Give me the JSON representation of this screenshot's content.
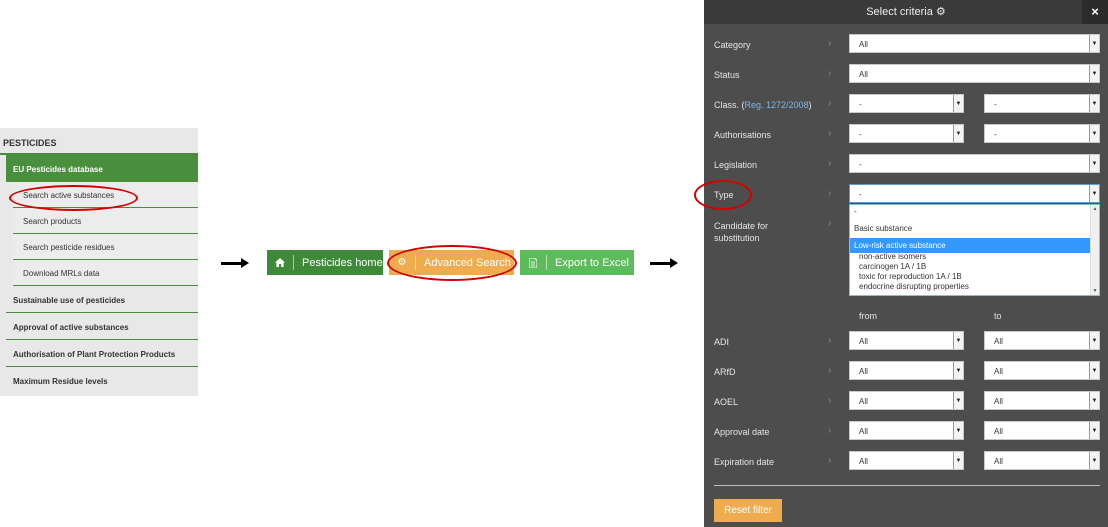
{
  "menu": {
    "header": "PESTICIDES",
    "active": "EU Pesticides database",
    "subitems": [
      "Search active substances",
      "Search products",
      "Search pesticide residues",
      "Download MRLs data"
    ],
    "items": [
      "Sustainable use of pesticides",
      "Approval of active substances",
      "Authorisation of Plant Protection Products",
      "Maximum Residue levels"
    ]
  },
  "buttons": {
    "home": "Pesticides home",
    "advanced": "Advanced Search",
    "export": "Export to Excel"
  },
  "panel": {
    "title": "Select criteria",
    "close": "×",
    "rows": {
      "category": {
        "label": "Category",
        "value": "All"
      },
      "status": {
        "label": "Status",
        "value": "All"
      },
      "class": {
        "label": "Class. (",
        "reg": "Reg. 1272/2008",
        "after": ")",
        "from": "-",
        "to": "-"
      },
      "authorisations": {
        "label": "Authorisations",
        "from": "-",
        "to": "-"
      },
      "legislation": {
        "label": "Legislation",
        "value": "-"
      },
      "type": {
        "label": "Type",
        "value": "-"
      },
      "candidate": {
        "label": "Candidate for substitution"
      }
    },
    "type_options": [
      "-",
      "Basic substance",
      "Low-risk active substance",
      "non-active isomers",
      "carcinogen 1A / 1B",
      "toxic for reproduction 1A / 1B",
      "endocrine disrupting properties"
    ],
    "from_label": "from",
    "to_label": "to",
    "range_rows": [
      {
        "label": "ADI",
        "from": "All",
        "to": "All"
      },
      {
        "label": "ARfD",
        "from": "All",
        "to": "All"
      },
      {
        "label": "AOEL",
        "from": "All",
        "to": "All"
      },
      {
        "label": "Approval date",
        "from": "All",
        "to": "All"
      },
      {
        "label": "Expiration date",
        "from": "All",
        "to": "All"
      }
    ],
    "reset": "Reset filter"
  },
  "icons": {
    "chevron": "›",
    "dropdown": "▼",
    "home": "home-icon",
    "gears": "gears-icon",
    "excel": "file-icon"
  },
  "colors": {
    "accent_green": "#3f8a38",
    "accent_orange": "#eeac4e",
    "highlight": "#d40000"
  }
}
